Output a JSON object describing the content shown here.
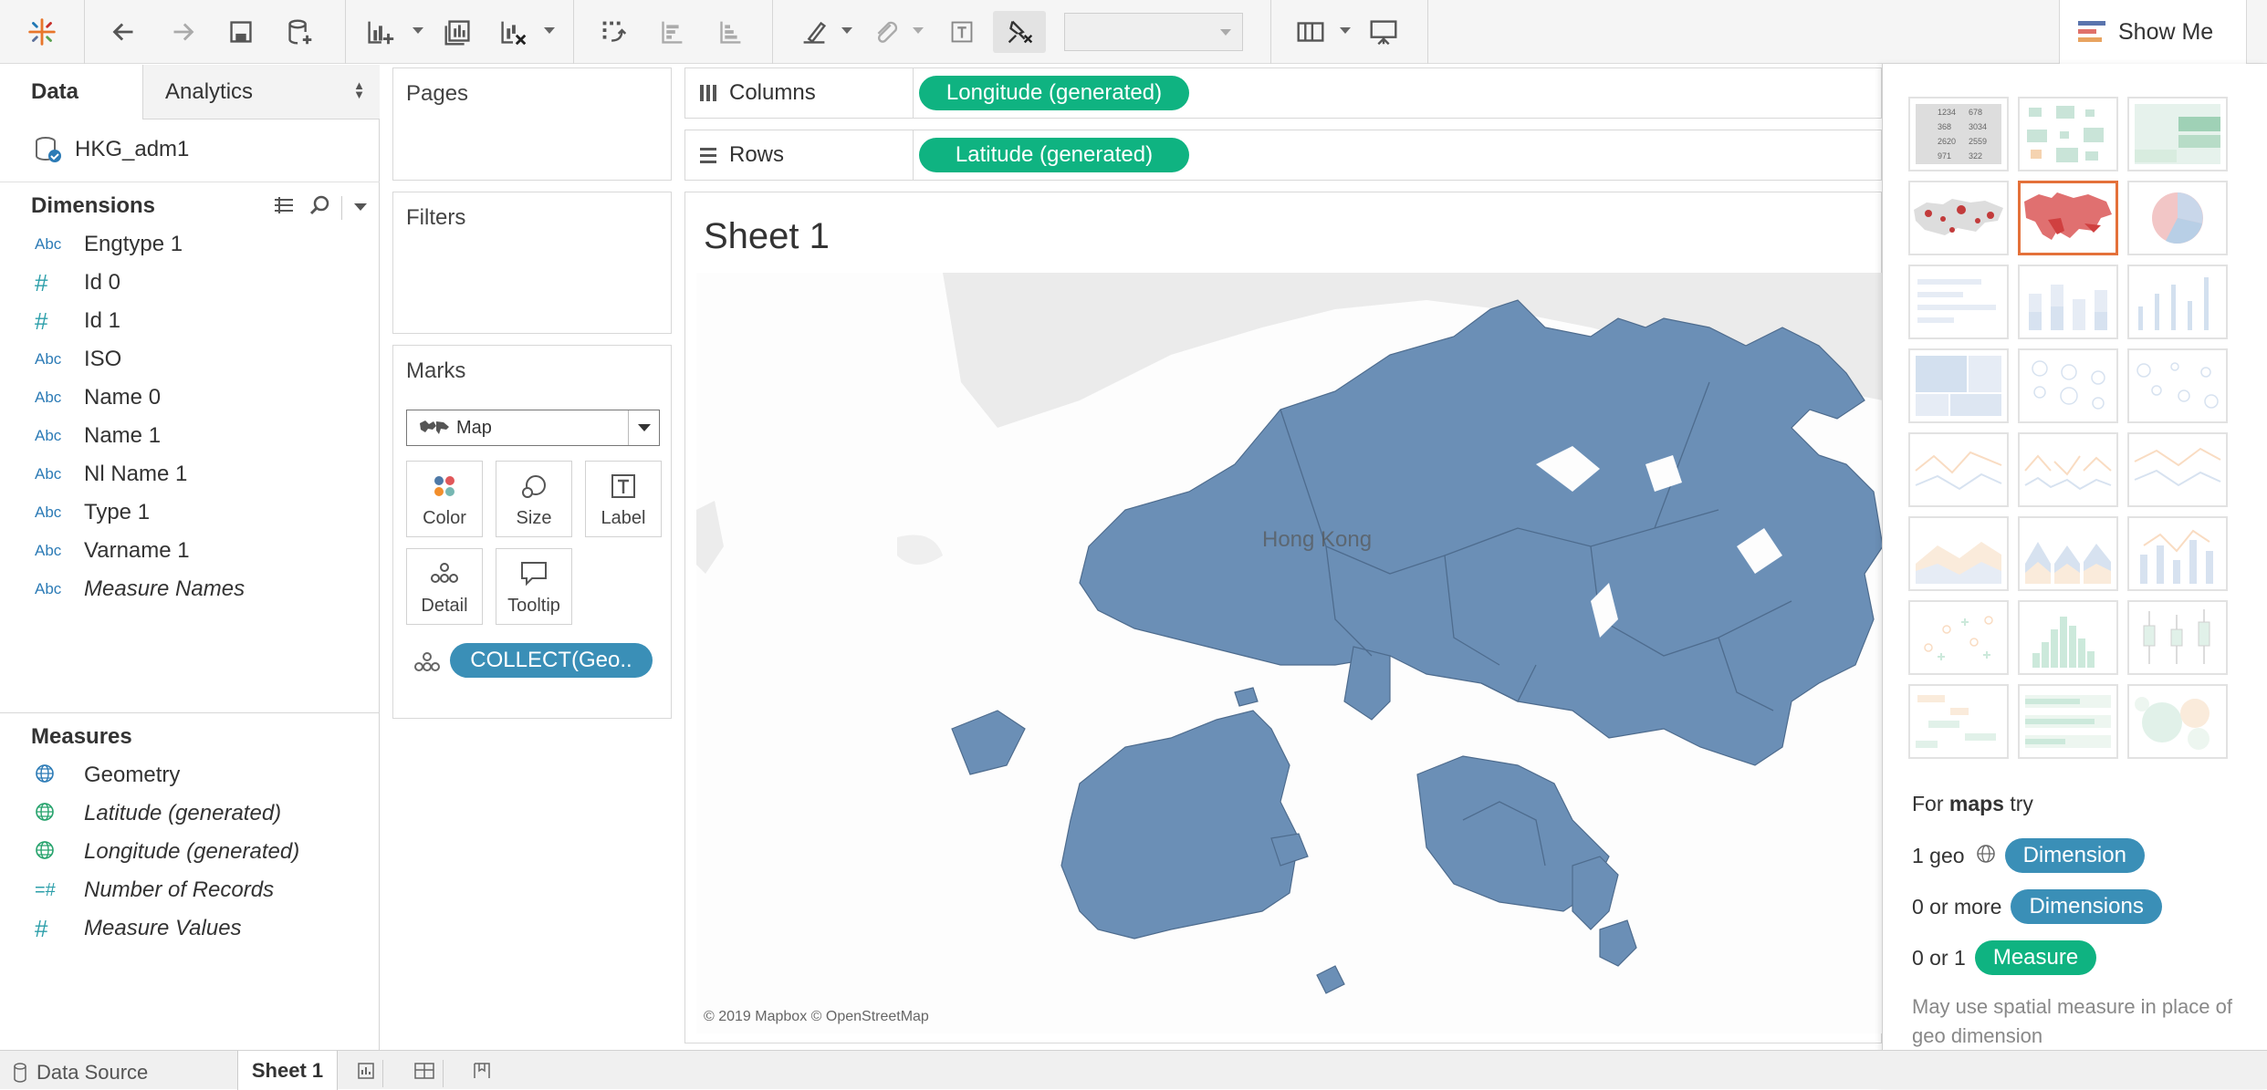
{
  "toolbar": {
    "items": [
      "tableau-logo-icon",
      "undo-icon",
      "redo-icon",
      "save-icon",
      "new-data-source-icon",
      "new-worksheet-icon",
      "duplicate-sheet-icon",
      "clear-sheet-icon",
      "swap-rows-columns-icon",
      "sort-ascending-icon",
      "sort-descending-icon",
      "highlight-icon",
      "group-members-icon",
      "show-mark-labels-icon",
      "pin-axes-icon",
      "fit-dropdown",
      "show-cards-icon",
      "presentation-mode-icon"
    ],
    "fit_value": ""
  },
  "show_me": {
    "label": "Show Me"
  },
  "sidebar": {
    "tabs": [
      {
        "label": "Data"
      },
      {
        "label": "Analytics"
      }
    ],
    "datasource": "HKG_adm1",
    "dimensions_title": "Dimensions",
    "dimensions": [
      {
        "type": "Abc",
        "name": "Engtype 1",
        "italic": false
      },
      {
        "type": "#",
        "name": "Id 0",
        "italic": false
      },
      {
        "type": "#",
        "name": "Id 1",
        "italic": false
      },
      {
        "type": "Abc",
        "name": "ISO",
        "italic": false
      },
      {
        "type": "Abc",
        "name": "Name 0",
        "italic": false
      },
      {
        "type": "Abc",
        "name": "Name 1",
        "italic": false
      },
      {
        "type": "Abc",
        "name": "Nl Name 1",
        "italic": false
      },
      {
        "type": "Abc",
        "name": "Type 1",
        "italic": false
      },
      {
        "type": "Abc",
        "name": "Varname 1",
        "italic": false
      },
      {
        "type": "Abc",
        "name": "Measure Names",
        "italic": true
      }
    ],
    "measures_title": "Measures",
    "measures": [
      {
        "type": "globe",
        "name": "Geometry",
        "italic": false
      },
      {
        "type": "globe",
        "name": "Latitude (generated)",
        "italic": true
      },
      {
        "type": "globe",
        "name": "Longitude (generated)",
        "italic": true
      },
      {
        "type": "=#",
        "name": "Number of Records",
        "italic": true
      },
      {
        "type": "#",
        "name": "Measure Values",
        "italic": true
      }
    ]
  },
  "pages": {
    "title": "Pages"
  },
  "filters": {
    "title": "Filters"
  },
  "marks": {
    "title": "Marks",
    "type": "Map",
    "buttons": [
      "Color",
      "Size",
      "Label",
      "Detail",
      "Tooltip"
    ],
    "pill": "COLLECT(Geo.."
  },
  "shelves": {
    "columns_label": "Columns",
    "columns_pill": "Longitude (generated)",
    "rows_label": "Rows",
    "rows_pill": "Latitude (generated)"
  },
  "sheet": {
    "title": "Sheet 1",
    "map_label": "Hong Kong",
    "attribution": "© 2019 Mapbox © OpenStreetMap",
    "fill_color": "#6b8fb6"
  },
  "showme": {
    "hint_prefix": "For ",
    "hint_bold": "maps",
    "hint_suffix": " try",
    "rows": [
      {
        "text": "1 geo",
        "pill": "Dimension",
        "color": "blue"
      },
      {
        "text": "0 or more",
        "pill": "Dimensions",
        "color": "blue"
      },
      {
        "text": "0 or 1",
        "pill": "Measure",
        "color": "green"
      }
    ],
    "note": "May use spatial measure in place of geo dimension",
    "selected_index": 4
  },
  "bottom": {
    "datasource_tab": "Data Source",
    "sheet_tab": "Sheet 1"
  },
  "colors": {
    "accent_green": "#0fb381",
    "accent_blue": "#3a8fb7",
    "selected_border": "#e4713a"
  }
}
